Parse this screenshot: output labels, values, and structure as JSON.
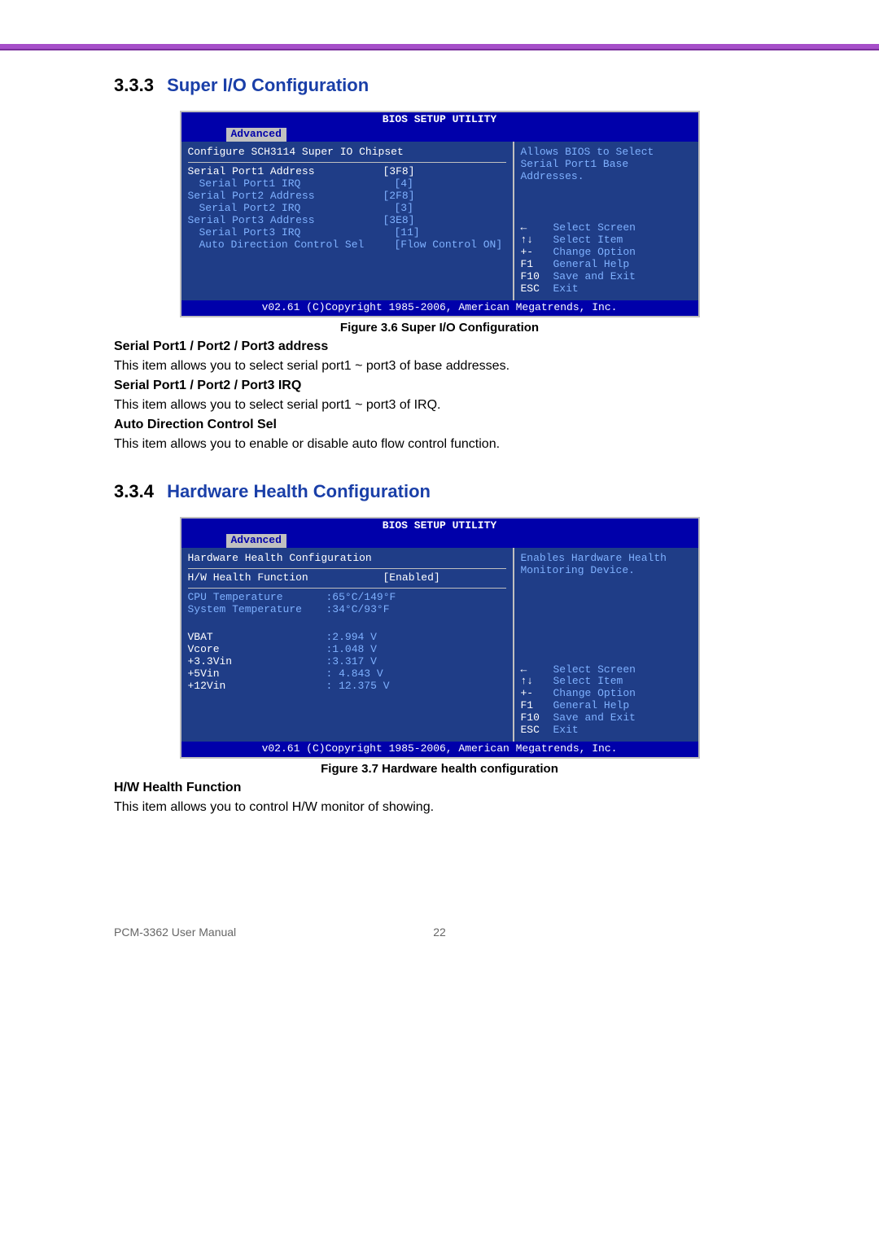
{
  "section1": {
    "number": "3.3.3",
    "title": "Super I/O Configuration"
  },
  "bios1": {
    "header": "BIOS SETUP UTILITY",
    "tab": "Advanced",
    "section_head": "Configure SCH3114 Super IO Chipset",
    "rows": [
      {
        "label": "Serial Port1 Address",
        "value": "[3F8]",
        "selected": true
      },
      {
        "label": "Serial Port1 IRQ",
        "value": "[4]",
        "indent": true
      },
      {
        "label": "Serial Port2 Address",
        "value": "[2F8]"
      },
      {
        "label": "Serial Port2 IRQ",
        "value": "[3]",
        "indent": true
      },
      {
        "label": "Serial Port3 Address",
        "value": "[3E8]"
      },
      {
        "label": "Serial Port3 IRQ",
        "value": "[11]",
        "indent": true
      },
      {
        "label": "Auto Direction Control Sel",
        "value": "[Flow Control ON]",
        "indent": true
      }
    ],
    "help_top": "Allows BIOS to Select Serial Port1 Base Addresses.",
    "help_bottom": [
      {
        "key": "←",
        "desc": "Select Screen"
      },
      {
        "key": "↑↓",
        "desc": "Select Item"
      },
      {
        "key": "+-",
        "desc": "Change Option"
      },
      {
        "key": "F1",
        "desc": "General Help"
      },
      {
        "key": "F10",
        "desc": "Save and Exit"
      },
      {
        "key": "ESC",
        "desc": "Exit"
      }
    ],
    "footer": "v02.61 (C)Copyright 1985-2006, American Megatrends, Inc."
  },
  "caption1": "Figure 3.6 Super I/O Configuration",
  "para1": {
    "h1": "Serial Port1 / Port2 / Port3 address",
    "p1": "This item allows you to select serial port1 ~ port3 of base addresses.",
    "h2": "Serial Port1 / Port2 / Port3 IRQ",
    "p2": "This item allows you to select serial port1 ~ port3 of IRQ.",
    "h3": "Auto Direction Control Sel",
    "p3": "This item allows you to enable or disable auto flow control function."
  },
  "section2": {
    "number": "3.3.4",
    "title": "Hardware Health Configuration"
  },
  "bios2": {
    "header": "BIOS SETUP UTILITY",
    "tab": "Advanced",
    "section_head": "Hardware Health Configuration",
    "function_row": {
      "label": "H/W Health Function",
      "value": "[Enabled]"
    },
    "temps": [
      {
        "label": "CPU Temperature",
        "value": ":65°C/149°F"
      },
      {
        "label": "System Temperature",
        "value": ":34°C/93°F"
      }
    ],
    "volts": [
      {
        "label": "VBAT",
        "value": ":2.994 V"
      },
      {
        "label": "Vcore",
        "value": ":1.048 V"
      },
      {
        "label": "+3.3Vin",
        "value": ":3.317 V"
      },
      {
        "label": "+5Vin",
        "value": ": 4.843 V"
      },
      {
        "label": "+12Vin",
        "value": ": 12.375 V"
      }
    ],
    "help_top": "Enables Hardware Health Monitoring Device.",
    "help_bottom": [
      {
        "key": "←",
        "desc": "Select Screen"
      },
      {
        "key": "↑↓",
        "desc": "Select Item"
      },
      {
        "key": "+-",
        "desc": "Change Option"
      },
      {
        "key": "F1",
        "desc": "General Help"
      },
      {
        "key": "F10",
        "desc": "Save and Exit"
      },
      {
        "key": "ESC",
        "desc": "Exit"
      }
    ],
    "footer": "v02.61 (C)Copyright 1985-2006, American Megatrends, Inc."
  },
  "caption2": "Figure 3.7 Hardware health configuration",
  "para2": {
    "h1": "H/W Health Function",
    "p1": "This item allows you to control H/W monitor of showing."
  },
  "footer": {
    "left": "PCM-3362 User Manual",
    "center": "22"
  }
}
